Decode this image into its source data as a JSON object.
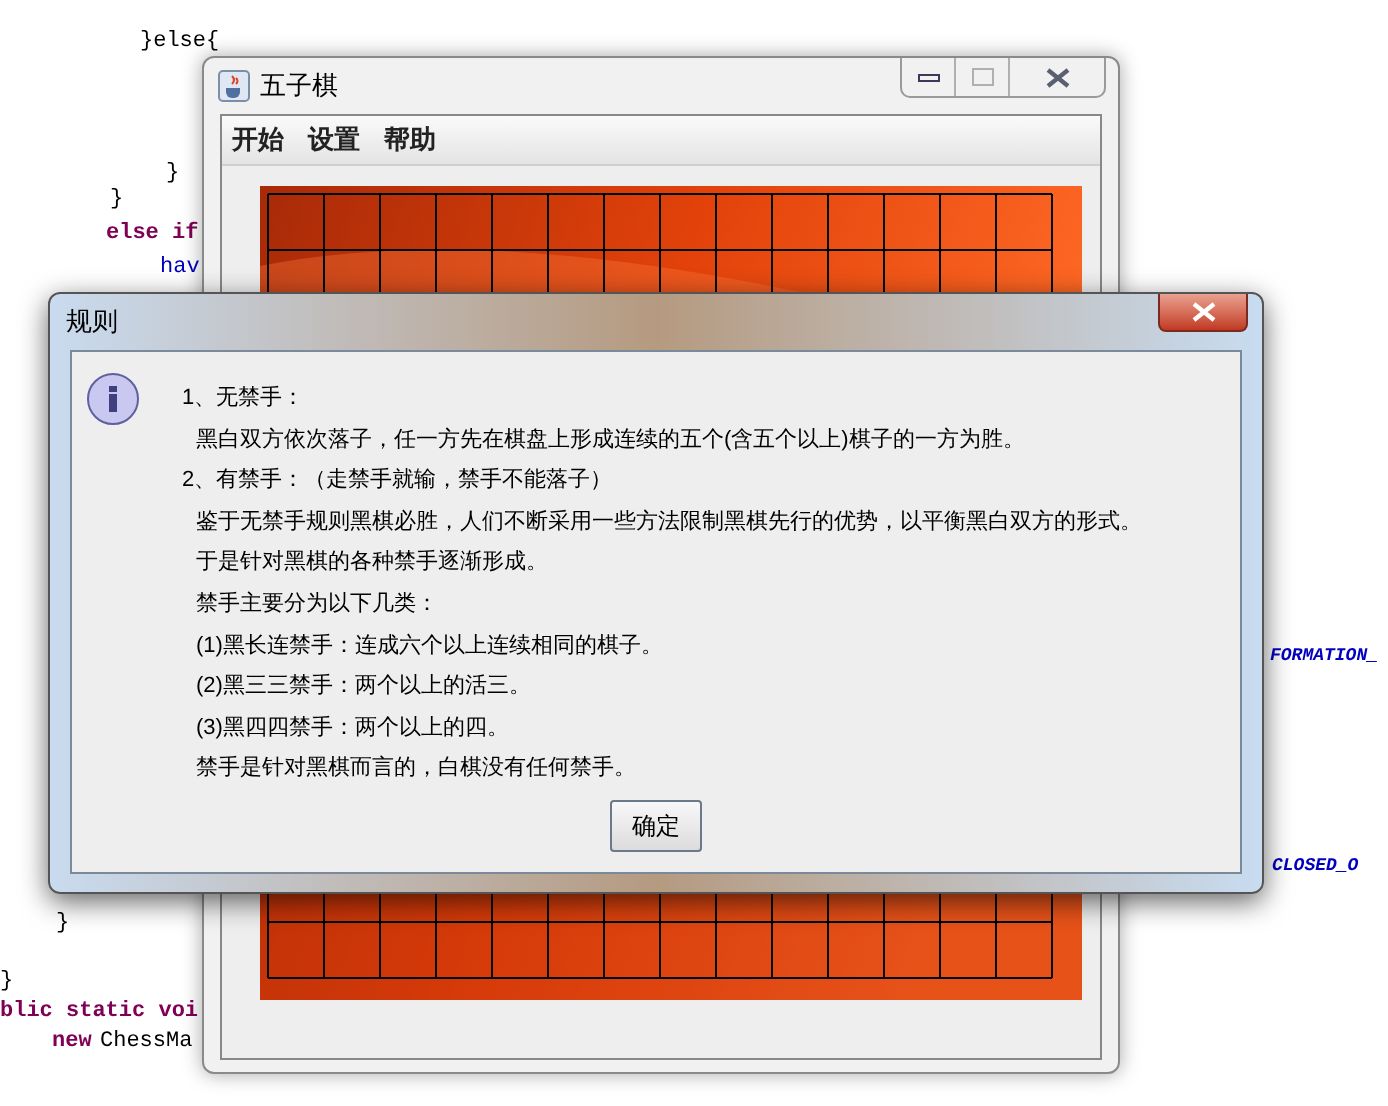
{
  "editor": {
    "fragments": [
      {
        "text": "}else{",
        "kind": "plain"
      },
      {
        "text": "}",
        "kind": "plain"
      },
      {
        "text": "}",
        "kind": "plain"
      },
      {
        "text": "else if",
        "kind": "keyword"
      },
      {
        "text": "hav",
        "kind": "field"
      },
      {
        "text": "FORMATION_",
        "kind": "constant"
      },
      {
        "text": "CLOSED_O",
        "kind": "constant"
      },
      {
        "text": "}",
        "kind": "plain"
      },
      {
        "text": "}",
        "kind": "plain"
      },
      {
        "text": "blic static voi",
        "kind": "keyword"
      },
      {
        "text": "new",
        "kind": "keyword"
      },
      {
        "text": "ChessMa",
        "kind": "plain"
      }
    ]
  },
  "game_window": {
    "title": "五子棋",
    "menu": [
      "开始",
      "设置",
      "帮助"
    ]
  },
  "dialog": {
    "title": "规则",
    "lines": [
      {
        "text": "1、无禁手：",
        "kind": "heading"
      },
      {
        "text": "黑白双方依次落子，任一方先在棋盘上形成连续的五个(含五个以上)棋子的一方为胜。",
        "kind": "body"
      },
      {
        "text": "2、有禁手：（走禁手就输，禁手不能落子）",
        "kind": "heading"
      },
      {
        "text": "鉴于无禁手规则黑棋必胜，人们不断采用一些方法限制黑棋先行的优势，以平衡黑白双方的形式。",
        "kind": "body"
      },
      {
        "text": "于是针对黑棋的各种禁手逐渐形成。",
        "kind": "body"
      },
      {
        "text": "禁手主要分为以下几类：",
        "kind": "body"
      },
      {
        "text": "(1)黑长连禁手：连成六个以上连续相同的棋子。",
        "kind": "body"
      },
      {
        "text": "(2)黑三三禁手：两个以上的活三。",
        "kind": "body"
      },
      {
        "text": "(3)黑四四禁手：两个以上的四。",
        "kind": "body"
      },
      {
        "text": "禁手是针对黑棋而言的，白棋没有任何禁手。",
        "kind": "body"
      }
    ],
    "button": "确定"
  }
}
